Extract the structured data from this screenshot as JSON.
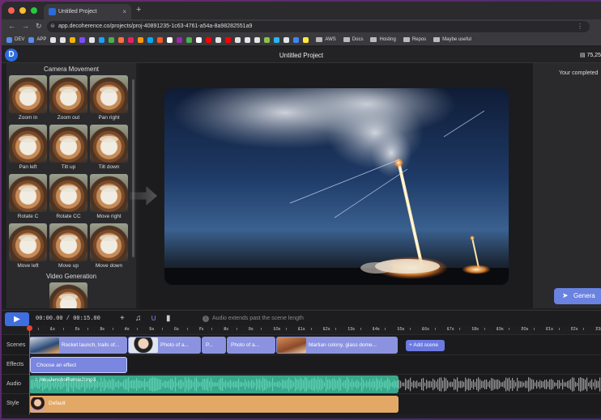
{
  "browser": {
    "tab_title": "Untitled Project",
    "tab_close": "×",
    "new_tab": "+",
    "url": "app.decoherence.co/projects/proj-40891235-1c63-4761-a54a-8a98282551a9",
    "bookmarks": [
      {
        "label": "DEV",
        "color": "#5b8def"
      },
      {
        "label": "APP",
        "color": "#5b8def"
      },
      {
        "label": "",
        "color": "#e5e5e5"
      },
      {
        "label": "",
        "color": "#e5e5e5"
      },
      {
        "label": "",
        "color": "#f4b400"
      },
      {
        "label": "",
        "color": "#7c4dff"
      },
      {
        "label": "",
        "color": "#e5e5e5"
      },
      {
        "label": "",
        "color": "#1da1f2"
      },
      {
        "label": "",
        "color": "#4caf50"
      },
      {
        "label": "",
        "color": "#ff7043"
      },
      {
        "label": "",
        "color": "#e91e63"
      },
      {
        "label": "",
        "color": "#ff9800"
      },
      {
        "label": "",
        "color": "#03a9f4"
      },
      {
        "label": "",
        "color": "#ff5722"
      },
      {
        "label": "",
        "color": "#ffffff"
      },
      {
        "label": "",
        "color": "#9c27b0"
      },
      {
        "label": "",
        "color": "#4caf50"
      },
      {
        "label": "",
        "color": "#ffffff"
      },
      {
        "label": "",
        "color": "#ff0000"
      },
      {
        "label": "",
        "color": "#e5e5e5"
      },
      {
        "label": "",
        "color": "#ff0000"
      },
      {
        "label": "",
        "color": "#e5e5e5"
      },
      {
        "label": "",
        "color": "#e5e5e5"
      },
      {
        "label": "",
        "color": "#e5e5e5"
      },
      {
        "label": "",
        "color": "#8bc34a"
      },
      {
        "label": "",
        "color": "#29b6f6"
      },
      {
        "label": "",
        "color": "#e5e5e5"
      },
      {
        "label": "",
        "color": "#4285f4"
      },
      {
        "label": "",
        "color": "#ffeb3b"
      }
    ],
    "bookmark_folders": [
      "AWS",
      "Docs",
      "Hosting",
      "Repos",
      "Maybe useful"
    ]
  },
  "app": {
    "logo_letter": "D",
    "project_title": "Untitled Project",
    "credits": "75,25"
  },
  "left_panel": {
    "title": "Camera Movement",
    "moves": [
      "Zoom in",
      "Zoom out",
      "Pan right",
      "Pan left",
      "Tilt up",
      "Tilt down",
      "Rotate C",
      "Rotate CC",
      "Move right",
      "Move left",
      "Move up",
      "Move down"
    ],
    "video_generation_title": "Video Generation"
  },
  "right_panel": {
    "completed_text": "Your completed",
    "generate_label": "Genera"
  },
  "timeline": {
    "play_icon": "▶",
    "timecode": "00:00.00 / 00:15.00",
    "info_text": "Audio extends past the scene length",
    "ruler": [
      "1s",
      "2s",
      "3s",
      "4s",
      "5s",
      "6s",
      "7s",
      "8s",
      "9s",
      "10s",
      "11s",
      "12s",
      "13s",
      "14s",
      "15s",
      "16s",
      "17s",
      "18s",
      "19s",
      "20s",
      "21s",
      "22s",
      "23s"
    ],
    "tracks": {
      "scenes_label": "Scenes",
      "effects_label": "Effects",
      "audio_label": "Audio",
      "style_label": "Style"
    },
    "scene_clips": [
      {
        "label": "Rocket launch, trails of...",
        "thumb": "rocket"
      },
      {
        "label": "Photo of a...",
        "thumb": "portrait"
      },
      {
        "label": "P...",
        "thumb": ""
      },
      {
        "label": "Photo of a...",
        "thumb": ""
      },
      {
        "label": "Martian colony, glass dome...",
        "thumb": "mars"
      }
    ],
    "add_scene_label": "+ Add scene",
    "effect_clip_label": "Choose an effect",
    "audio_clip_label": "InkuJenchoRemix2.mp3",
    "style_clip_label": "Default",
    "audio_color": "#5ed0b0",
    "style_color": "#e3a866",
    "scene_color": "#8b93e0"
  }
}
